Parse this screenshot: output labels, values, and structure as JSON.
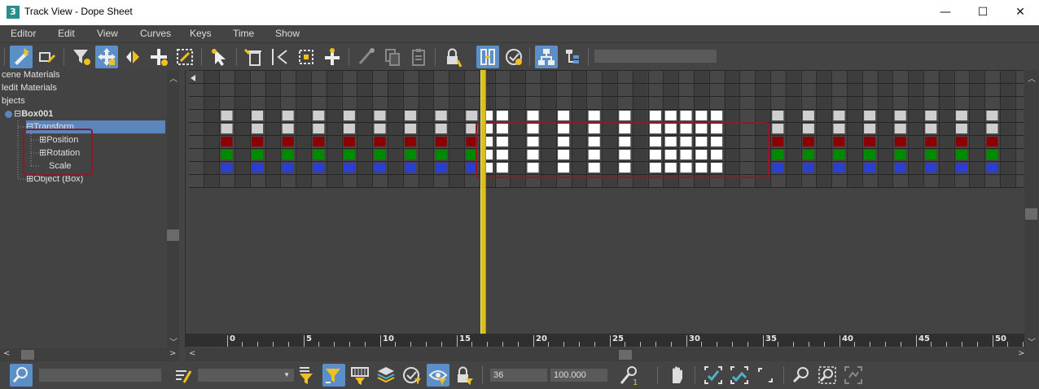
{
  "window": {
    "app_icon": "3",
    "title": "Track View - Dope Sheet",
    "minimize": "—",
    "maximize": "☐",
    "close": "✕"
  },
  "menu": [
    "Editor",
    "Edit",
    "View",
    "Curves",
    "Keys",
    "Time",
    "Show"
  ],
  "tree": {
    "scene_materials": "cene Materials",
    "medit_materials": "ledit Materials",
    "objects": "bjects",
    "box": "Box001",
    "transform": "Transform",
    "position": "Position",
    "rotation": "Rotation",
    "scale": "Scale",
    "object_box": "Object (Box)",
    "expand_minus": "⊟",
    "expand_plus": "⊞"
  },
  "ruler": {
    "labels": [
      "0",
      "5",
      "10",
      "15",
      "20",
      "25",
      "30",
      "35",
      "40",
      "45",
      "50"
    ]
  },
  "dope_sheet": {
    "selected_frames": [
      17,
      18,
      20,
      22,
      24,
      26,
      28,
      29,
      30,
      31,
      32
    ],
    "unselected_frames": [
      0,
      2,
      4,
      6,
      8,
      10,
      12,
      14,
      16,
      36,
      38,
      40,
      42,
      44,
      46,
      48,
      50
    ],
    "current_frame_marker": 16.5,
    "colors": {
      "x_track": "#8e0000",
      "y_track": "#008a00",
      "z_track": "#2a3ed0",
      "key_grey": "#cfcfcf",
      "key_selected": "#ffffff",
      "time_slider": "#d8c21a",
      "selection_outline": "#8b1c24"
    }
  },
  "bottom": {
    "current_frame": "36",
    "value": "100.000",
    "search_placeholder": "",
    "filter_dropdown": ""
  },
  "icons": {
    "top": [
      "filter-wand-icon",
      "edit-ranges-icon",
      "filter-icon",
      "move-keys-icon",
      "slide-keys-icon",
      "add-keys-icon",
      "scale-keys-icon",
      "select-cursor-icon",
      "delete-key-icon",
      "reduce-keys-icon",
      "region-select-icon",
      "insert-time-icon",
      "select-time-icon",
      "copy-icon",
      "paste-icon",
      "lock-selection-icon",
      "snap-frames-icon",
      "show-keyable-icon",
      "modify-subtree-icon",
      "modify-child-keys-icon"
    ],
    "bottom": [
      "zoom-selected-icon",
      "key-mode-icon",
      "filter-selected-icon",
      "filter-animated-icon",
      "filter-frames-icon",
      "layer-icon",
      "show-selected-icon",
      "show-filter-icon",
      "lock-tracks-icon",
      "key-stats-icon",
      "pan-icon",
      "fit-horizontal-icon",
      "fit-all-icon",
      "frame-zoom-icon",
      "zoom-icon",
      "zoom-region-icon",
      "fit-screen-icon"
    ]
  }
}
